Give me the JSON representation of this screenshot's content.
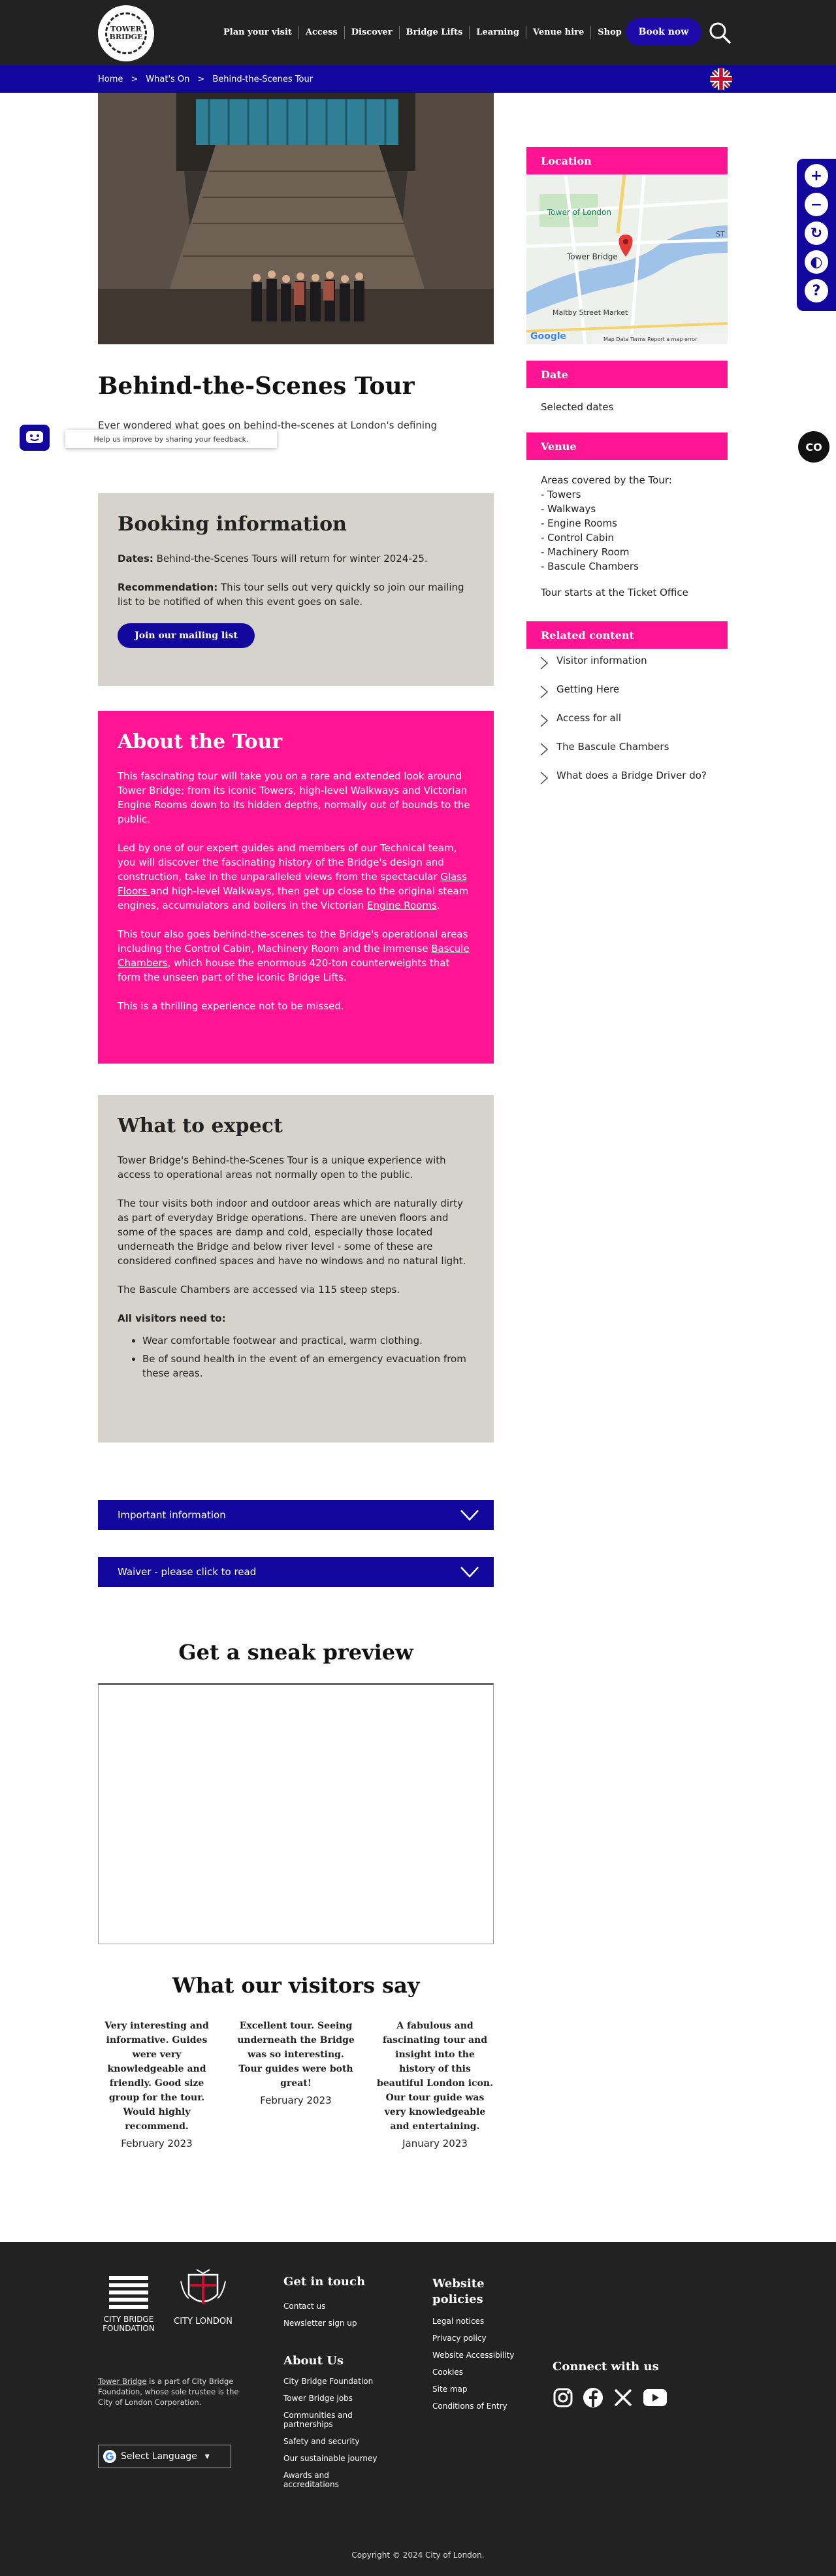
{
  "header": {
    "logo_text": "TOWER BRIDGE",
    "nav": [
      "Plan your visit",
      "Access",
      "Discover",
      "Bridge Lifts",
      "Learning",
      "Venue hire",
      "Shop"
    ],
    "book_now": "Book now"
  },
  "breadcrumb": [
    "Home",
    ">",
    "What's On",
    ">",
    "Behind-the-Scenes Tour"
  ],
  "page": {
    "title": "Behind-the-Scenes Tour",
    "lede": "Ever wondered what goes on behind-the-scenes at London's defining"
  },
  "feedback": {
    "tooltip": "Help us improve by sharing your feedback."
  },
  "booking": {
    "heading": "Booking information",
    "dates_label": "Dates:",
    "dates_text": " Behind-the-Scenes Tours will return for winter 2024-25.",
    "rec_label": "Recommendation:",
    "rec_text": " This tour sells out very quickly so join our mailing list to be notified of when this event goes on sale.",
    "button": "Join our mailing list"
  },
  "about": {
    "heading": "About the Tour",
    "p1": "This fascinating tour will take you on a rare and extended look around Tower Bridge; from its iconic Towers, high-level Walkways and Victorian Engine Rooms down to its hidden depths, normally out of bounds to the public.",
    "p2_a": "Led by one of our expert guides and members of our Technical team, you will discover the fascinating history of the Bridge's design and construction, take in the unparalleled views from the spectacular ",
    "p2_link1": "Glass Floors ",
    "p2_b": "and high-level Walkways, then get up close to the original steam engines, accumulators and boilers in the Victorian ",
    "p2_link2": "Engine Rooms",
    "p2_c": ".",
    "p3_a": "This tour also goes behind-the-scenes to the Bridge's operational areas including the Control Cabin, Machinery Room and the immense ",
    "p3_link": "Bascule Chambers",
    "p3_b": ", which house the enormous 420-ton counterweights that form the unseen part of the iconic Bridge Lifts.",
    "p4": "This is a thrilling experience not to be missed."
  },
  "expect": {
    "heading": "What to expect",
    "p1": "Tower Bridge's Behind-the-Scenes Tour is a unique experience with access to operational areas not normally open to the public.",
    "p2": "The tour visits both indoor and outdoor areas which are naturally dirty as part of everyday Bridge operations. There are uneven floors and some of the spaces are damp and cold, especially those located underneath the Bridge and below river level - some of these are considered confined spaces and have no windows and no natural light.",
    "p3": "The Bascule Chambers are accessed via 115 steep steps.",
    "needs_label": "All visitors need to:",
    "list": [
      "Wear comfortable footwear and practical, warm clothing.",
      "Be of sound health in the event of an emergency evacuation from these areas."
    ]
  },
  "accordions": [
    "Important information",
    "Waiver - please click to read"
  ],
  "sneak_preview": "Get a sneak preview",
  "reviews": {
    "heading": "What our visitors say",
    "items": [
      {
        "quote": "Very interesting and informative. Guides were very knowledgeable and friendly. Good size group for the tour. Would highly recommend.",
        "date": "February 2023"
      },
      {
        "quote": "Excellent tour. Seeing underneath the Bridge was so interesting. Tour guides were both great!",
        "date": "February 2023"
      },
      {
        "quote": "A fabulous and fascinating tour and insight into the history of this beautiful London icon. Our tour guide was very knowledgeable and entertaining.",
        "date": "January 2023"
      }
    ]
  },
  "sidebar": {
    "location": "Location",
    "map_labels": {
      "tower": "Tower of London",
      "bridge": "Tower Bridge",
      "market": "Maltby Street Market",
      "google": "Google",
      "attrib": "Map Data   Terms   Report a map error",
      "st": "ST"
    },
    "date_heading": "Date",
    "date_text": "Selected dates",
    "venue_heading": "Venue",
    "venue_lines": [
      "Areas covered by the Tour:",
      "- Towers",
      "- Walkways",
      "- Engine Rooms",
      "- Control Cabin",
      "- Machinery Room",
      "- Bascule Chambers"
    ],
    "venue_start": "Tour starts at the Ticket Office",
    "related_heading": "Related content",
    "related": [
      "Visitor information",
      "Getting Here",
      "Access for all",
      "The Bascule Chambers",
      "What does a Bridge Driver do?"
    ]
  },
  "footer": {
    "cbf": "CITY BRIDGE FOUNDATION",
    "city": "CITY LONDON",
    "text_link": "Tower Bridge",
    "text": " is a part of City Bridge Foundation, whose sole trustee is the City of London Corporation.",
    "language": "Select Language",
    "get_in_touch": "Get in touch",
    "touch_links": [
      "Contact us",
      "Newsletter sign up"
    ],
    "about_us": "About Us",
    "about_links": [
      "City Bridge Foundation",
      "Tower Bridge jobs",
      "Communities and partnerships",
      "Safety and security",
      "Our sustainable journey",
      "Awards and accreditations"
    ],
    "policies": "Website policies",
    "policy_links": [
      "Legal notices",
      "Privacy policy",
      "Website Accessibility",
      "Cookies",
      "Site map",
      "Conditions of Entry"
    ],
    "connect": "Connect with us",
    "copyright": "Copyright © 2024 City of London."
  },
  "colors": {
    "navy": "#12079d",
    "pink": "#ff1493",
    "beige": "#d6d2cc",
    "dark": "#222222"
  }
}
